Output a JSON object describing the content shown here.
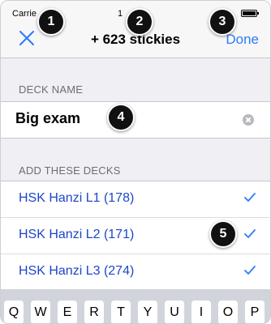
{
  "status": {
    "carrier": "Carrie",
    "time": "1"
  },
  "nav": {
    "title": "+ 623 stickies",
    "done_label": "Done"
  },
  "badges": [
    "1",
    "2",
    "3",
    "4",
    "5"
  ],
  "deck_name": {
    "header": "DECK NAME",
    "value": "Big exam"
  },
  "decks": {
    "header": "ADD THESE DECKS",
    "items": [
      {
        "label": "HSK Hanzi L1 (178)",
        "checked": true
      },
      {
        "label": "HSK Hanzi L2 (171)",
        "checked": true
      },
      {
        "label": "HSK Hanzi L3 (274)",
        "checked": true
      }
    ]
  },
  "keyboard": {
    "keys": [
      "Q",
      "W",
      "E",
      "R",
      "T",
      "Y",
      "U",
      "I",
      "O",
      "P"
    ]
  },
  "colors": {
    "accent": "#2c7cf6",
    "deck_text": "#1d46c8",
    "checkmark": "#2c7cf6",
    "badge": "#111111"
  }
}
